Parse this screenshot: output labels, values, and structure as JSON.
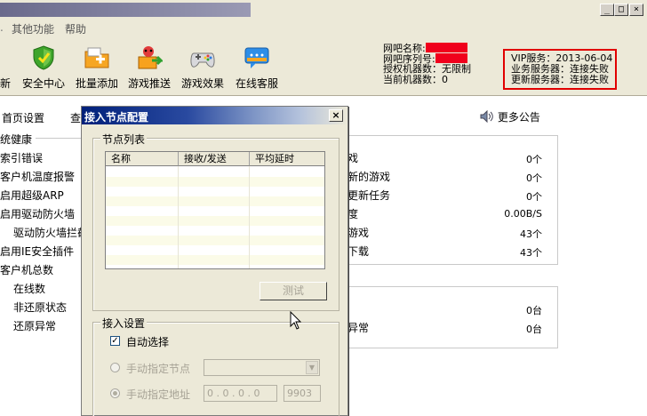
{
  "window": {
    "minimize": "_",
    "maximize": "□",
    "close": "×"
  },
  "menu": {
    "items": [
      "其他功能",
      "帮助"
    ]
  },
  "toolbar": {
    "items": [
      {
        "label": "新"
      },
      {
        "label": "安全中心"
      },
      {
        "label": "批量添加"
      },
      {
        "label": "游戏推送"
      },
      {
        "label": "游戏效果"
      },
      {
        "label": "在线客服"
      }
    ]
  },
  "info": {
    "netbar_name": "网吧名称:",
    "netbar_serial": "网吧序列号:",
    "licensed_machines": "授权机器数：无限制",
    "current_machines": "当前机器数：0"
  },
  "vip": {
    "service": "VIP服务：2013-06-04",
    "business_server": "业务服务器：连接失败",
    "update_server": "更新服务器：连接失败"
  },
  "main": {
    "tab_home": "首页设置",
    "tab_query": "查",
    "announcement": "更多公告",
    "left_section_title": "统健康",
    "left_rows": [
      "索引错误",
      "客户机温度报警",
      "启用超级ARP",
      "启用驱动防火墙",
      "驱动防火墙拦截",
      "启用IE安全插件",
      "客户机总数",
      "在线数",
      "非还原状态",
      "还原异常"
    ],
    "right_rows": [
      {
        "label": "戏",
        "value": "0个"
      },
      {
        "label": "新的游戏",
        "value": "0个"
      },
      {
        "label": "更新任务",
        "value": "0个"
      },
      {
        "label": "度",
        "value": "0.00B/S"
      },
      {
        "label": "游戏",
        "value": "43个"
      },
      {
        "label": "下载",
        "value": "43个"
      }
    ],
    "right_rows2": [
      {
        "label": "",
        "value": "0台"
      },
      {
        "label": "异常",
        "value": "0台"
      }
    ]
  },
  "dialog": {
    "title": "接入节点配置",
    "close": "×",
    "node_list_title": "节点列表",
    "columns": [
      "名称",
      "接收/发送",
      "平均延时"
    ],
    "test_button": "测试",
    "access_settings_title": "接入设置",
    "auto_select": "自动选择",
    "manual_node": "手动指定节点",
    "manual_address": "手动指定地址",
    "ip_value": "0 . 0 . 0 . 0",
    "port_value": "9903"
  }
}
